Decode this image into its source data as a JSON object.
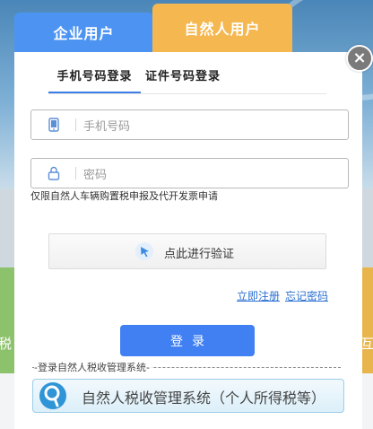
{
  "tabs": {
    "enterprise": "企业用户",
    "natural": "自然人用户"
  },
  "subtabs": {
    "phone": "手机号码登录",
    "cert": "证件号码登录"
  },
  "fields": {
    "phone_placeholder": "手机号码",
    "password_placeholder": "密码"
  },
  "note": "仅限自然人车辆购置税申报及代开发票申请",
  "verify": {
    "label": "点此进行验证"
  },
  "links": {
    "register": "立即注册",
    "forgot": "忘记密码"
  },
  "login_button": "登录",
  "divider_text": "-登录自然人税收管理系统-",
  "system_button": "自然人税收管理系统（个人所得税等）",
  "background": {
    "left_tile_char": "税",
    "right_tile_char": "互"
  },
  "colors": {
    "enterprise_tab": "#4d94f2",
    "natural_tab": "#f5b74f",
    "login_button": "#4180f2",
    "link": "#2a6fd0"
  }
}
